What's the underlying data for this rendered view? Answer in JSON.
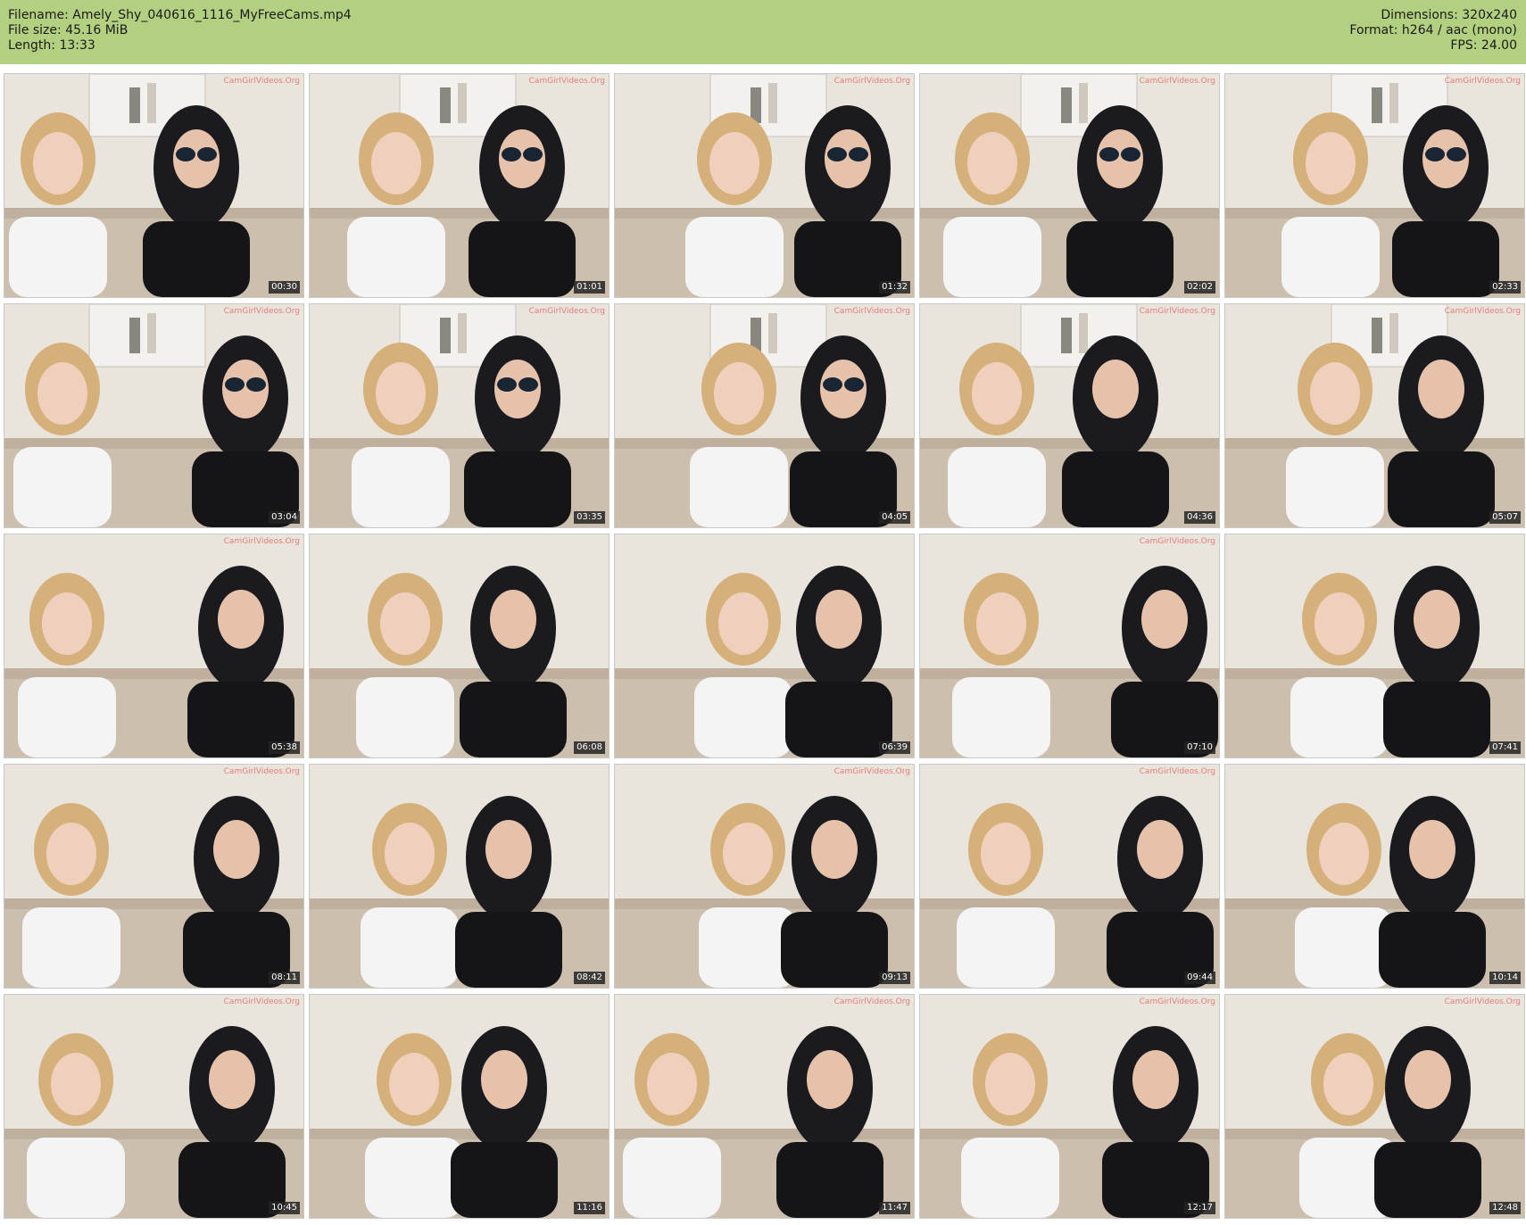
{
  "header": {
    "filename": "Filename: Amely_Shy_040616_1116_MyFreeCams.mp4",
    "filesize": "File size: 45.16 MiB",
    "length": "Length: 13:33",
    "dimensions": "Dimensions: 320x240",
    "format": "Format: h264 / aac (mono)",
    "fps": "FPS: 24.00"
  },
  "colors": {
    "header_bg": "#b3d080",
    "timestamp_bg": "#232323"
  },
  "watermark": "CamGirlVideos.Org",
  "thumbnails": [
    {
      "time": "00:30",
      "wm": true
    },
    {
      "time": "01:01",
      "wm": true
    },
    {
      "time": "01:32",
      "wm": true
    },
    {
      "time": "02:02",
      "wm": true
    },
    {
      "time": "02:33",
      "wm": true
    },
    {
      "time": "03:04",
      "wm": true
    },
    {
      "time": "03:35",
      "wm": true
    },
    {
      "time": "04:05",
      "wm": true
    },
    {
      "time": "04:36",
      "wm": true
    },
    {
      "time": "05:07",
      "wm": true
    },
    {
      "time": "05:38",
      "wm": true
    },
    {
      "time": "06:08",
      "wm": false
    },
    {
      "time": "06:39",
      "wm": false
    },
    {
      "time": "07:10",
      "wm": true
    },
    {
      "time": "07:41",
      "wm": false
    },
    {
      "time": "08:11",
      "wm": true
    },
    {
      "time": "08:42",
      "wm": false
    },
    {
      "time": "09:13",
      "wm": true
    },
    {
      "time": "09:44",
      "wm": true
    },
    {
      "time": "10:14",
      "wm": false
    },
    {
      "time": "10:45",
      "wm": true
    },
    {
      "time": "11:16",
      "wm": false
    },
    {
      "time": "11:47",
      "wm": true
    },
    {
      "time": "12:17",
      "wm": true
    },
    {
      "time": "12:48",
      "wm": true
    }
  ]
}
